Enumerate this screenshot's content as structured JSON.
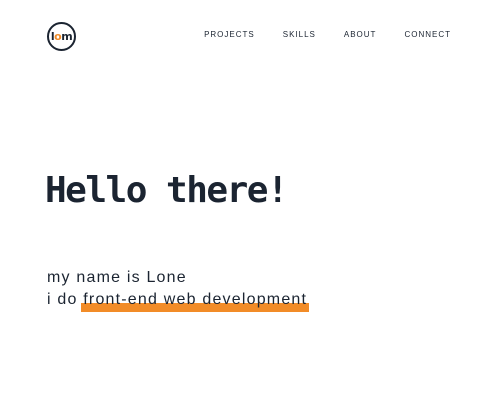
{
  "header": {
    "logo": {
      "prefix": "l",
      "accent": "o",
      "suffix": "m"
    },
    "nav": [
      {
        "label": "PROJECTS"
      },
      {
        "label": "SKILLS"
      },
      {
        "label": "ABOUT"
      },
      {
        "label": "CONNECT"
      }
    ]
  },
  "hero": {
    "headline": "Hello there!",
    "line1": "my name is Lone",
    "line2_prefix": "i do",
    "line2_highlight": "front-end web development"
  },
  "colors": {
    "text": "#1b2431",
    "accent": "#f28c28",
    "background": "#ffffff"
  }
}
